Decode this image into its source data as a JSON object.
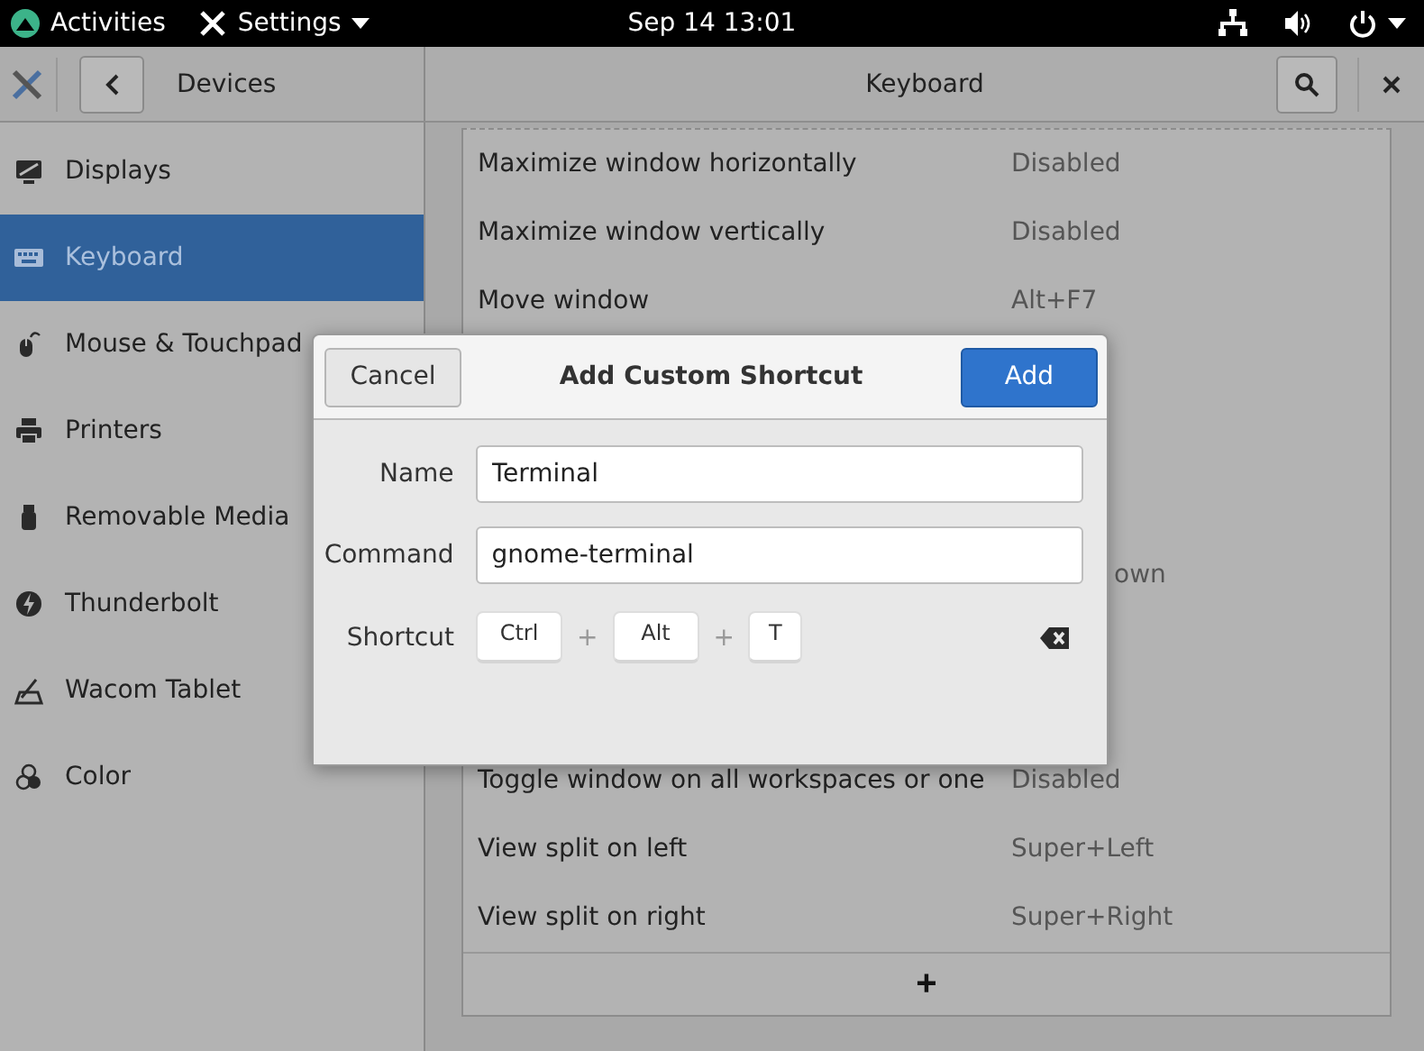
{
  "top_bar": {
    "activities": "Activities",
    "app_menu": "Settings",
    "clock": "Sep 14  13:01"
  },
  "header": {
    "section": "Devices",
    "title": "Keyboard"
  },
  "sidebar": {
    "items": [
      {
        "label": "Displays",
        "selected": false
      },
      {
        "label": "Keyboard",
        "selected": true
      },
      {
        "label": "Mouse & Touchpad",
        "selected": false
      },
      {
        "label": "Printers",
        "selected": false
      },
      {
        "label": "Removable Media",
        "selected": false
      },
      {
        "label": "Thunderbolt",
        "selected": false
      },
      {
        "label": "Wacom Tablet",
        "selected": false
      },
      {
        "label": "Color",
        "selected": false
      }
    ]
  },
  "shortcuts": [
    {
      "kind": "full",
      "name": "Maximize window horizontally",
      "value": "Disabled"
    },
    {
      "kind": "full",
      "name": "Maximize window vertically",
      "value": "Disabled"
    },
    {
      "kind": "full",
      "name": "Move window",
      "value": "Alt+F7"
    },
    {
      "kind": "hidden"
    },
    {
      "kind": "hidden"
    },
    {
      "kind": "hidden"
    },
    {
      "kind": "value_only",
      "value": "own"
    },
    {
      "kind": "hidden"
    },
    {
      "kind": "hidden"
    },
    {
      "kind": "full",
      "name": "Toggle window on all workspaces or one",
      "value": "Disabled"
    },
    {
      "kind": "full",
      "name": "View split on left",
      "value": "Super+Left"
    },
    {
      "kind": "full",
      "name": "View split on right",
      "value": "Super+Right"
    }
  ],
  "add_row": "+",
  "dialog": {
    "title": "Add Custom Shortcut",
    "cancel": "Cancel",
    "confirm": "Add",
    "fields": [
      {
        "label": "Name",
        "value": "Terminal"
      },
      {
        "label": "Command",
        "value": "gnome-terminal"
      }
    ],
    "shortcut_label": "Shortcut",
    "keys": [
      "Ctrl",
      "Alt",
      "T"
    ],
    "separator": "+"
  }
}
